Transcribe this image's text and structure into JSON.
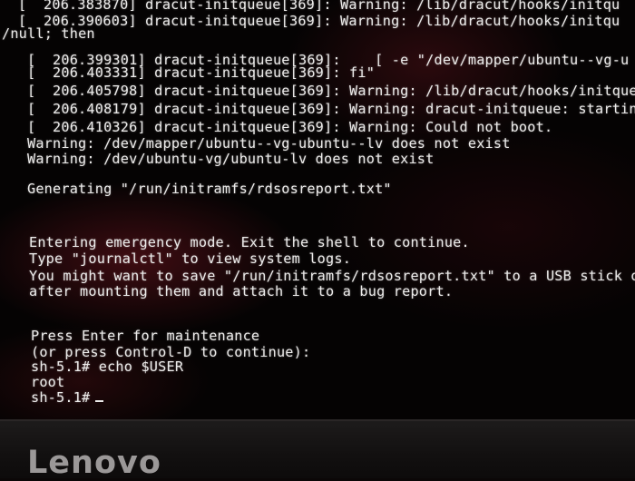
{
  "terminal": {
    "lines": [
      "[  206.383870] dracut-initqueue[369]: Warning: /lib/dracut/hooks/initqu",
      "[  206.390603] dracut-initqueue[369]: Warning: /lib/dracut/hooks/initqu",
      "/null; then",
      "[  206.399301] dracut-initqueue[369]:    [ -e \"/dev/mapper/ubuntu--vg-u",
      "[  206.403331] dracut-initqueue[369]: fi\"",
      "[  206.405798] dracut-initqueue[369]: Warning: /lib/dracut/hooks/initque",
      "[  206.408179] dracut-initqueue[369]: Warning: dracut-initqueue: startin",
      "[  206.410326] dracut-initqueue[369]: Warning: Could not boot.",
      "Warning: /dev/mapper/ubuntu--vg-ubuntu--lv does not exist",
      "Warning: /dev/ubuntu-vg/ubuntu-lv does not exist",
      "Generating \"/run/initramfs/rdsosreport.txt\"",
      "Entering emergency mode. Exit the shell to continue.",
      "Type \"journalctl\" to view system logs.",
      "You might want to save \"/run/initramfs/rdsosreport.txt\" to a USB stick or",
      "after mounting them and attach it to a bug report.",
      "Press Enter for maintenance",
      "(or press Control-D to continue):",
      "sh-5.1# echo $USER",
      "root",
      "sh-5.1#"
    ]
  },
  "bezel": {
    "brand": "Lenovo"
  }
}
